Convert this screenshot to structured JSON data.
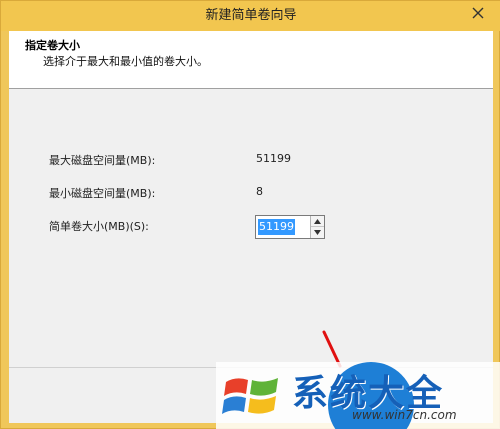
{
  "window": {
    "title": "新建简单卷向导"
  },
  "header": {
    "title": "指定卷大小",
    "subtitle": "选择介于最大和最小值的卷大小。"
  },
  "fields": {
    "max_label": "最大磁盘空间量(MB):",
    "max_value": "51199",
    "min_label": "最小磁盘空间量(MB):",
    "min_value": "8",
    "size_label": "简单卷大小(MB)(S):",
    "size_value": "51199"
  },
  "watermark": {
    "brand": "系统大全",
    "url": "www.win7cn.com"
  },
  "colors": {
    "titlebar": "#f2c64f",
    "selection": "#3399ff",
    "watermark_blue": "#1560b8"
  }
}
